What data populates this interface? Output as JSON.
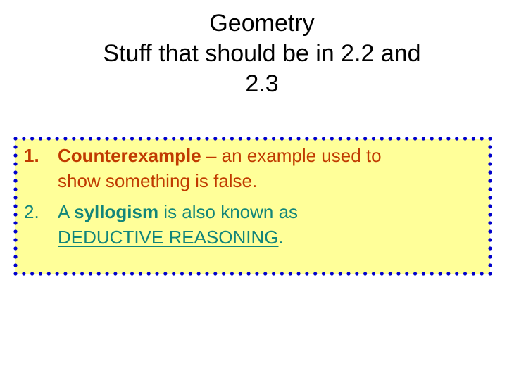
{
  "slide": {
    "title_lines": [
      "Geometry",
      "Stuff that should be in 2.2  and",
      "2.3"
    ],
    "colors": {
      "title": "#000000",
      "box_fill": "#FFFF99",
      "box_border_dots": "#0000CC",
      "item1_text": "#C03A00",
      "item2_text": "#12857A"
    },
    "items": [
      {
        "number": "1.",
        "term": "Counterexample",
        "line1_rest": " – an example used to",
        "line2": "show something is false."
      },
      {
        "number": "2.",
        "prefix": "A ",
        "term": "syllogism",
        "line1_rest": " is also known as",
        "emphasis": "DEDUCTIVE REASONING",
        "suffix": "."
      }
    ]
  }
}
